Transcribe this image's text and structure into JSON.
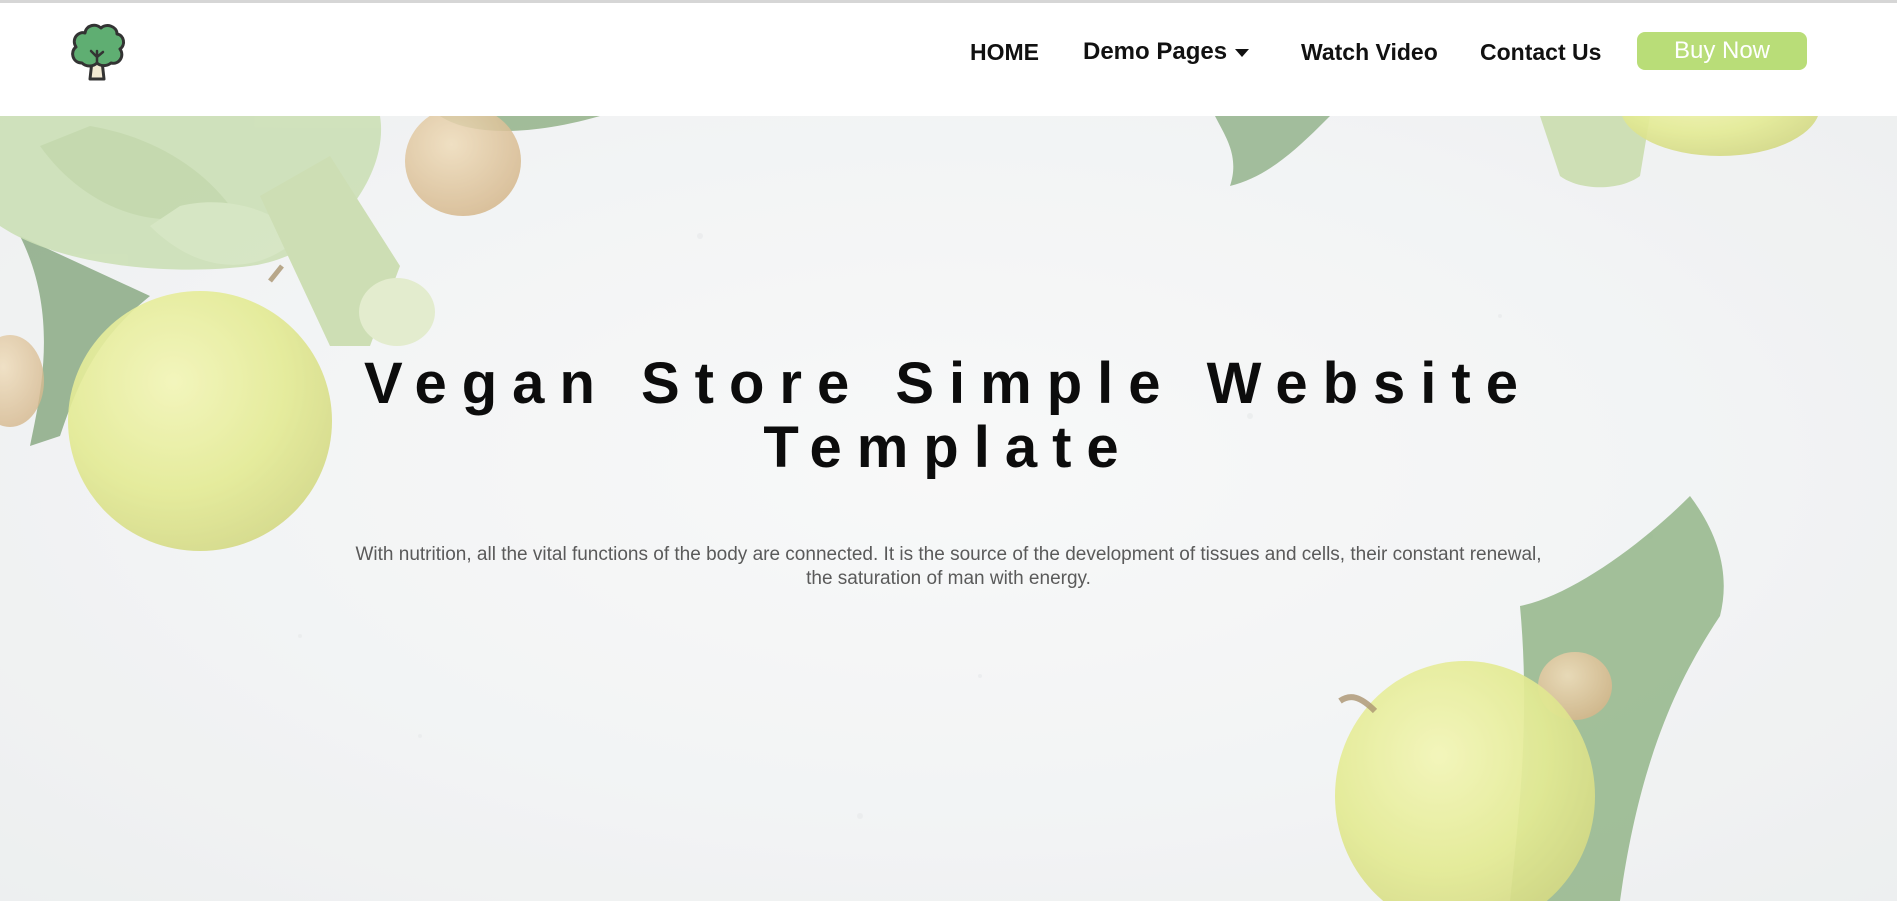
{
  "nav": {
    "home": "HOME",
    "demo_pages": "Demo Pages",
    "watch_video": "Watch Video",
    "contact_us": "Contact Us",
    "buy_now": "Buy Now"
  },
  "hero": {
    "title_line1": "Vegan Store Simple Website",
    "title_line2": "Template",
    "description_line1": "With nutrition, all the vital functions of the body are connected. It is the source of the development of tissues and cells, their constant renewal,",
    "description_line2": "the saturation of man with energy."
  },
  "icons": {
    "logo": "broccoli-tree-icon",
    "dropdown": "caret-down-icon"
  },
  "colors": {
    "accent": "#b9dd78",
    "logo_green": "#5fae72",
    "text_dark": "#111111",
    "text_muted": "#5a5a5a"
  }
}
